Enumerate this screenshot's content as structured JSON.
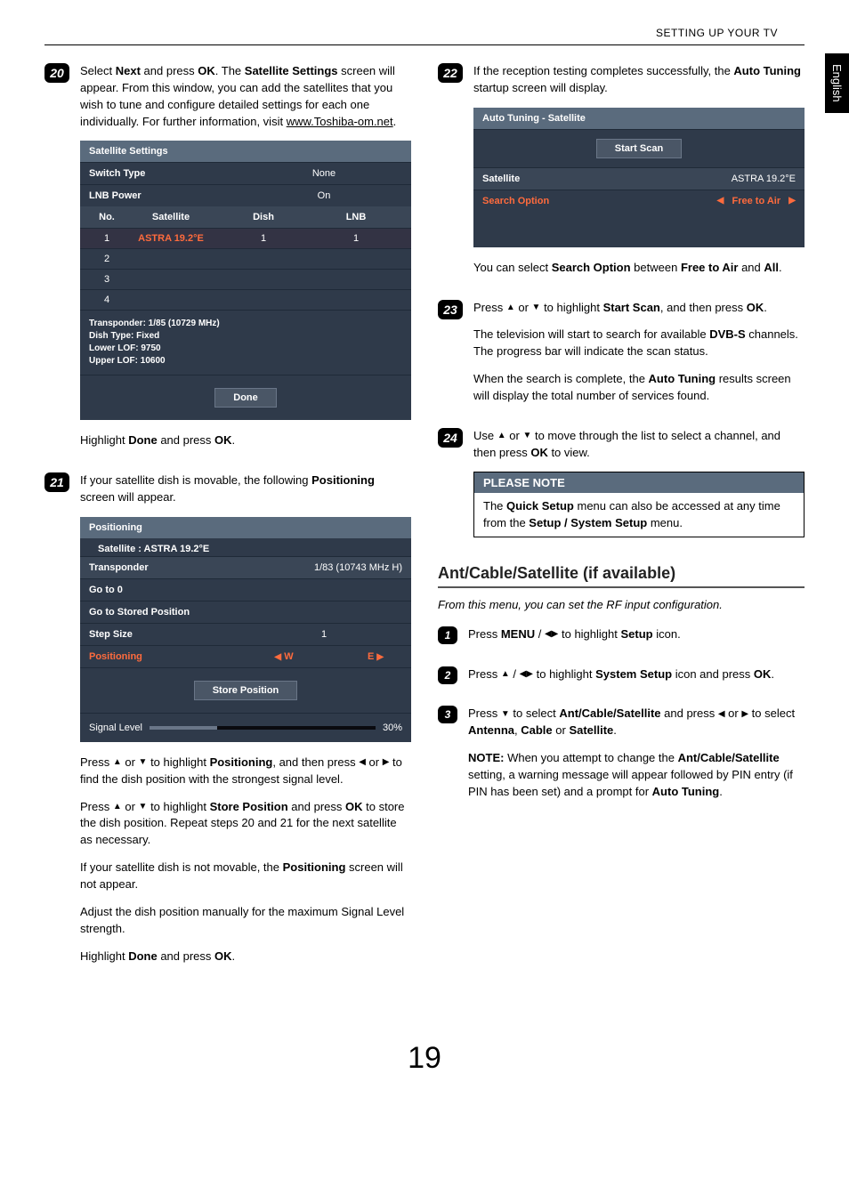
{
  "header": {
    "section": "SETTING UP YOUR TV",
    "side_tab": "English"
  },
  "left": {
    "step20": {
      "num": "20",
      "text_before": "Select ",
      "next": "Next",
      "text_mid1": " and press ",
      "ok": "OK",
      "text_mid2": ". The ",
      "sat_settings": "Satellite Settings",
      "text_after": " screen will appear. From this window, you can add the satellites that you wish to tune and configure detailed settings for each one individually. For further information, visit ",
      "link": "www.Toshiba-om.net",
      "dot": "."
    },
    "panel_sat": {
      "title": "Satellite Settings",
      "switch_lbl": "Switch Type",
      "switch_val": "None",
      "lnb_lbl": "LNB Power",
      "lnb_val": "On",
      "th_no": "No.",
      "th_sat": "Satellite",
      "th_dish": "Dish",
      "th_lnb": "LNB",
      "rows": [
        {
          "no": "1",
          "sat": "ASTRA 19.2°E",
          "dish": "1",
          "lnb": "1"
        },
        {
          "no": "2",
          "sat": "",
          "dish": "",
          "lnb": ""
        },
        {
          "no": "3",
          "sat": "",
          "dish": "",
          "lnb": ""
        },
        {
          "no": "4",
          "sat": "",
          "dish": "",
          "lnb": ""
        }
      ],
      "info1": "Transponder: 1/85 (10729 MHz)",
      "info2": "Dish Type: Fixed",
      "info3": "Lower LOF: 9750",
      "info4": "Upper LOF: 10600",
      "done": "Done"
    },
    "after_sat_1a": "Highlight ",
    "after_sat_done": "Done",
    "after_sat_1b": " and press ",
    "after_sat_ok": "OK",
    "after_sat_1c": ".",
    "step21": {
      "num": "21",
      "text1": "If your satellite dish is movable, the following ",
      "positioning": "Positioning",
      "text2": " screen will appear."
    },
    "panel_pos": {
      "title": "Positioning",
      "sub": "Satellite : ASTRA 19.2°E",
      "trans_lbl": "Transponder",
      "trans_val": "1/83 (10743 MHz  H)",
      "goto0": "Go to 0",
      "gotostored": "Go to Stored Position",
      "step_lbl": "Step Size",
      "step_val": "1",
      "pos_lbl": "Positioning",
      "pos_w": "W",
      "pos_e": "E",
      "store": "Store Position",
      "signal_lbl": "Signal Level",
      "signal_val": "30%",
      "signal_pct": 30
    },
    "p21a_1": "Press ",
    "p21a_2": " or ",
    "p21a_3": " to highlight ",
    "p21a_pos": "Positioning",
    "p21a_4": ", and then press ",
    "p21a_5": " or ",
    "p21a_6": " to find the dish position with the strongest signal level.",
    "p21b_1": "Press ",
    "p21b_2": " or ",
    "p21b_3": " to highlight ",
    "p21b_sp": "Store Position",
    "p21b_4": " and press ",
    "p21b_ok": "OK",
    "p21b_5": " to store the dish position. Repeat steps 20 and 21 for the next satellite as necessary.",
    "p21c_1": "If your satellite dish is not movable, the ",
    "p21c_pos": "Positioning",
    "p21c_2": " screen will not appear.",
    "p21d": "Adjust the dish position manually for the maximum Signal Level strength.",
    "p21e_1": "Highlight ",
    "p21e_done": "Done",
    "p21e_2": " and press ",
    "p21e_ok": "OK",
    "p21e_3": "."
  },
  "right": {
    "step22": {
      "num": "22",
      "text1": "If the reception testing completes successfully, the ",
      "at": "Auto Tuning",
      "text2": " startup screen will display."
    },
    "panel_at": {
      "title": "Auto Tuning - Satellite",
      "start": "Start Scan",
      "sat_lbl": "Satellite",
      "sat_val": "ASTRA 19.2°E",
      "so_lbl": "Search Option",
      "so_val": "Free to Air"
    },
    "p22a_1": "You can select ",
    "p22a_so": "Search Option",
    "p22a_2": " between ",
    "p22a_fta": "Free to Air",
    "p22a_3": " and ",
    "p22a_all": "All",
    "p22a_4": ".",
    "step23": {
      "num": "23",
      "t1": "Press ",
      "t2": " or ",
      "t3": " to highlight ",
      "ss": "Start Scan",
      "t4": ", and then press ",
      "ok": "OK",
      "t5": ".",
      "p2a": "The television will start to search for available ",
      "dvbs": "DVB-S",
      "p2b": " channels. The progress bar will indicate the scan status.",
      "p3a": "When the search is complete, the ",
      "at": "Auto Tuning",
      "p3b": " results screen will display the total number of services found."
    },
    "step24": {
      "num": "24",
      "t1": "Use ",
      "t2": " or ",
      "t3": " to move through the list to select a channel, and then press ",
      "ok": "OK",
      "t4": " to view."
    },
    "note": {
      "head": "PLEASE NOTE",
      "b1": "The ",
      "qs": "Quick Setup",
      "b2": " menu can also be accessed at any time from the ",
      "ss": "Setup / System Setup",
      "b3": " menu."
    },
    "section": {
      "title": "Ant/Cable/Satellite (if available)",
      "sub": "From this menu, you can set the RF input configuration."
    },
    "s1": {
      "num": "1",
      "t1": "Press ",
      "menu": "MENU",
      "t2": " / ",
      "t3": " to highlight ",
      "setup": "Setup",
      "t4": " icon."
    },
    "s2": {
      "num": "2",
      "t1": "Press ",
      "t2": " / ",
      "t3": " to highlight ",
      "ss": "System Setup",
      "t4": " icon and press ",
      "ok": "OK",
      "t5": "."
    },
    "s3": {
      "num": "3",
      "t1": "Press ",
      "t2": " to select ",
      "acs": "Ant/Cable/Satellite",
      "t3": " and press ",
      "t4": " or ",
      "t5": " to select ",
      "ant": "Antenna",
      "c1": ", ",
      "cab": "Cable",
      "c2": " or ",
      "sat": "Satellite",
      "t6": ".",
      "note_lbl": "NOTE:",
      "note1": " When you attempt to change the ",
      "acs2": "Ant/Cable/Satellite",
      "note2": " setting, a warning message will appear followed by PIN entry (if PIN has been set) and a prompt for ",
      "at": "Auto Tuning",
      "note3": "."
    }
  },
  "page_num": "19"
}
